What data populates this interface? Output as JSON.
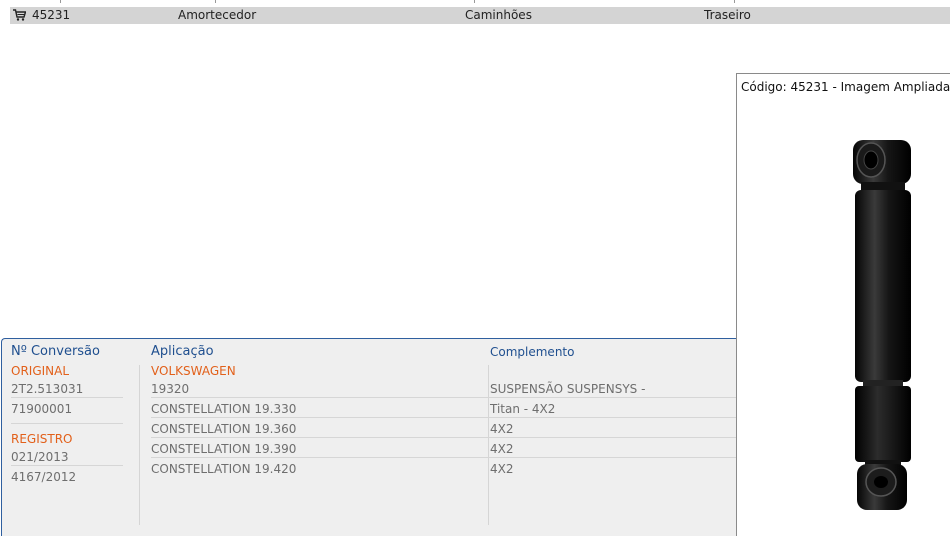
{
  "result_row": {
    "code": "45231",
    "description": "Amortecedor",
    "category": "Caminhões",
    "position": "Traseiro"
  },
  "conversion_panel": {
    "headers": {
      "conversion": "Nº Conversão",
      "application": "Aplicação",
      "complement": "Complemento"
    },
    "conversion": {
      "original_label": "ORIGINAL",
      "original_values": [
        "2T2.513031",
        "71900001"
      ],
      "registro_label": "REGISTRO",
      "registro_values": [
        "021/2013",
        "4167/2012"
      ]
    },
    "application": {
      "brand": "VOLKSWAGEN",
      "models": [
        "19320",
        "CONSTELLATION 19.330",
        "CONSTELLATION 19.360",
        "CONSTELLATION 19.390",
        "CONSTELLATION 19.420"
      ]
    },
    "complement": {
      "values": [
        "SUSPENSÃO SUSPENSYS -",
        "Titan - 4X2",
        "4X2",
        "4X2",
        "4X2"
      ]
    }
  },
  "popup": {
    "title": "Código: 45231 - Imagem Ampliada"
  },
  "icons": {
    "cart": "shopping-cart-icon",
    "image": "shock-absorber-image"
  },
  "colors": {
    "panel_border": "#2f5f9f",
    "header_text": "#1f4f8f",
    "section_label": "#e2601a",
    "value_text": "#6e6e6e",
    "row_background": "#d4d4d4"
  }
}
